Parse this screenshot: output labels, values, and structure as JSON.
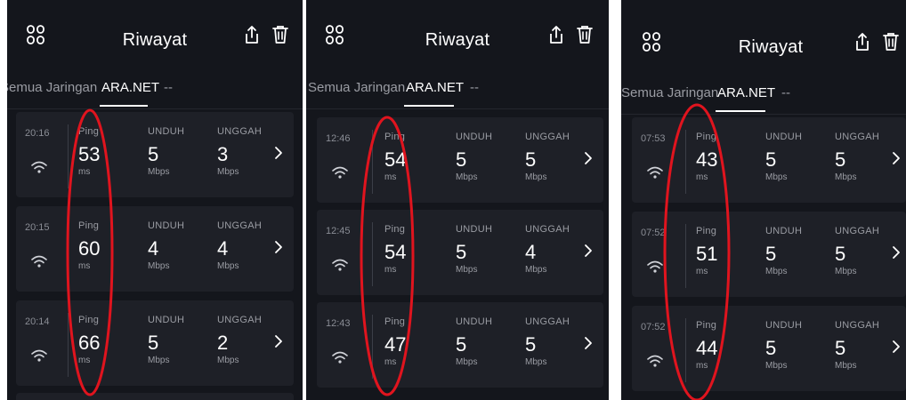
{
  "panels": [
    {
      "header": {
        "title": "Riwayat"
      },
      "tabs": {
        "all": "Semua Jaringan",
        "network": "ARA.NET",
        "other": "--"
      },
      "columns": {
        "ping": "Ping",
        "download": "UNDUH",
        "upload": "UNGGAH"
      },
      "units": {
        "ping": "ms",
        "speed": "Mbps"
      },
      "results": [
        {
          "time": "20:16",
          "ping": "53",
          "download": "5",
          "upload": "3"
        },
        {
          "time": "20:15",
          "ping": "60",
          "download": "4",
          "upload": "4"
        },
        {
          "time": "20:14",
          "ping": "66",
          "download": "5",
          "upload": "2"
        }
      ]
    },
    {
      "header": {
        "title": "Riwayat"
      },
      "tabs": {
        "all": "Semua Jaringan",
        "network": "ARA.NET",
        "other": "--"
      },
      "columns": {
        "ping": "Ping",
        "download": "UNDUH",
        "upload": "UNGGAH"
      },
      "units": {
        "ping": "ms",
        "speed": "Mbps"
      },
      "results": [
        {
          "time": "12:46",
          "ping": "54",
          "download": "5",
          "upload": "5"
        },
        {
          "time": "12:45",
          "ping": "54",
          "download": "5",
          "upload": "4"
        },
        {
          "time": "12:43",
          "ping": "47",
          "download": "5",
          "upload": "5"
        }
      ]
    },
    {
      "header": {
        "title": "Riwayat"
      },
      "tabs": {
        "all": "Semua Jaringan",
        "network": "ARA.NET",
        "other": "--"
      },
      "columns": {
        "ping": "Ping",
        "download": "UNDUH",
        "upload": "UNGGAH"
      },
      "units": {
        "ping": "ms",
        "speed": "Mbps"
      },
      "results": [
        {
          "time": "07:53",
          "ping": "43",
          "download": "5",
          "upload": "5"
        },
        {
          "time": "07:52",
          "ping": "51",
          "download": "5",
          "upload": "5"
        },
        {
          "time": "07:52",
          "ping": "44",
          "download": "5",
          "upload": "5"
        }
      ]
    }
  ],
  "colors": {
    "background": "#14161c",
    "card": "#1e2027",
    "text_primary": "#ffffff",
    "text_secondary": "#9a9ca3",
    "annotation": "#e0141e"
  },
  "icons": {
    "header_left": "apps-grid-icon",
    "header_share": "share-icon",
    "header_delete": "trash-icon",
    "connection": "wifi-icon",
    "row_action": "chevron-right-icon"
  }
}
